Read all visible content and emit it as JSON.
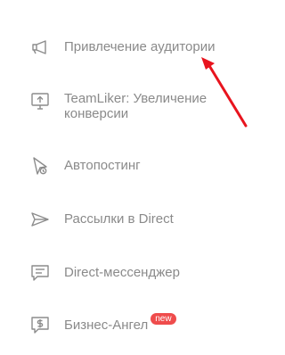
{
  "menu": {
    "items": [
      {
        "label": "Привлечение аудитории",
        "icon": "megaphone-icon"
      },
      {
        "label": "TeamLiker: Увеличение конверсии",
        "icon": "monitor-upload-icon"
      },
      {
        "label": "Автопостинг",
        "icon": "autopost-icon"
      },
      {
        "label": "Рассылки в Direct",
        "icon": "paper-plane-icon"
      },
      {
        "label": "Direct-мессенджер",
        "icon": "chat-icon"
      },
      {
        "label": "Бизнес-Ангел",
        "icon": "dollar-chat-icon",
        "badge": "new"
      }
    ]
  },
  "colors": {
    "text": "#8a8a8a",
    "icon": "#8c8c8c",
    "badge": "#ef4c4c",
    "arrow": "#e8141e"
  }
}
